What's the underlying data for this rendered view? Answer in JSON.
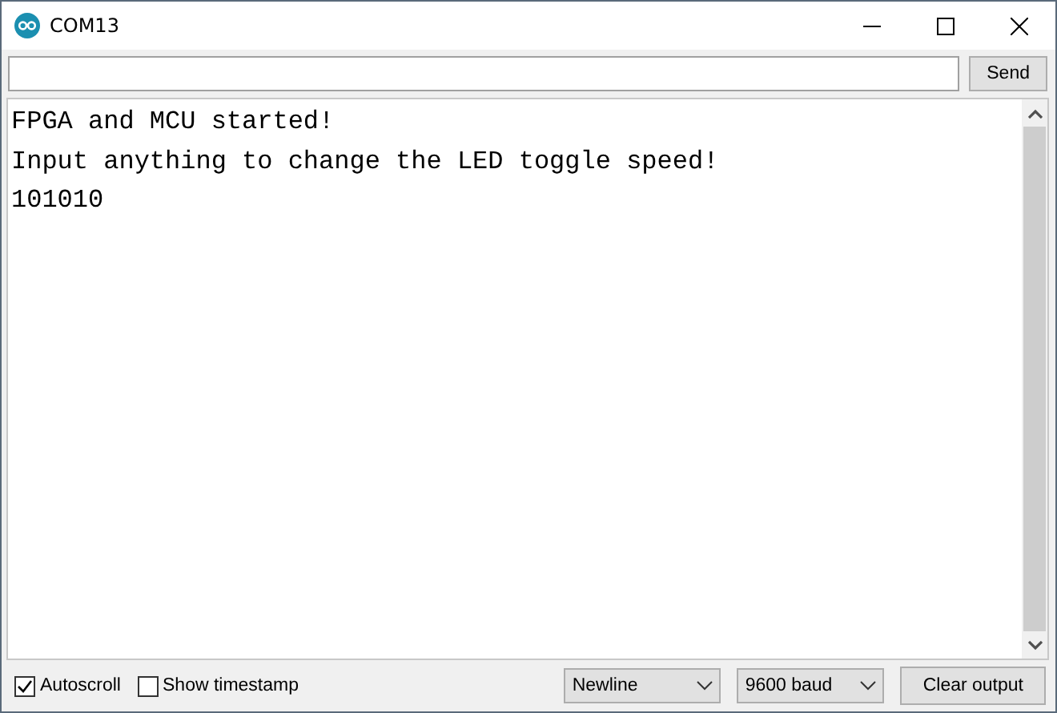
{
  "window": {
    "title": "COM13"
  },
  "input": {
    "button": "Send"
  },
  "output": {
    "lines": [
      "FPGA and MCU started!",
      "Input anything to change the LED toggle speed!",
      "101010"
    ]
  },
  "footer": {
    "checkboxes": [
      {
        "label": "Autoscroll",
        "checked": true
      },
      {
        "label": "Show timestamp",
        "checked": false
      }
    ],
    "dropdowns": [
      {
        "value": "Newline"
      },
      {
        "value": "9600 baud"
      }
    ],
    "button": "Clear output"
  }
}
